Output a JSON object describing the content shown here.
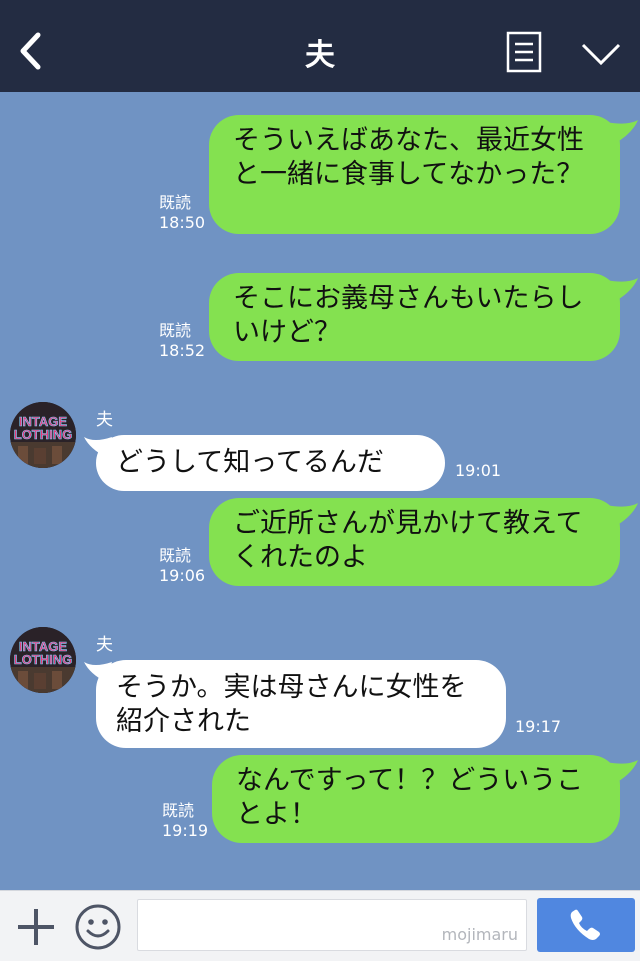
{
  "header": {
    "title": "夫"
  },
  "messages": [
    {
      "side": "right",
      "text": "そういえばあなた、最近女性と一緒に食事してなかった？",
      "read": "既読",
      "time": "18:50"
    },
    {
      "side": "right",
      "text": "そこにお義母さんもいたらしいけど？",
      "read": "既読",
      "time": "18:52"
    },
    {
      "side": "left",
      "sender": "夫",
      "avatar_text": [
        "INTAGE",
        "LOTHING"
      ],
      "text": "どうして知ってるんだ",
      "time": "19:01"
    },
    {
      "side": "right",
      "text": "ご近所さんが見かけて教えてくれたのよ",
      "read": "既読",
      "time": "19:06"
    },
    {
      "side": "left",
      "sender": "夫",
      "avatar_text": [
        "INTAGE",
        "LOTHING"
      ],
      "text": "そうか。実は母さんに女性を紹介された",
      "time": "19:17"
    },
    {
      "side": "right",
      "text": "なんですって！？どういうことよ！",
      "read": "既読",
      "time": "19:19"
    }
  ],
  "footer": {
    "watermark": "mojimaru"
  },
  "colors": {
    "header": "#232c42",
    "background": "#7093c3",
    "bubble_right": "#84e150",
    "bubble_left": "#ffffff",
    "call_button": "#5087e0"
  }
}
